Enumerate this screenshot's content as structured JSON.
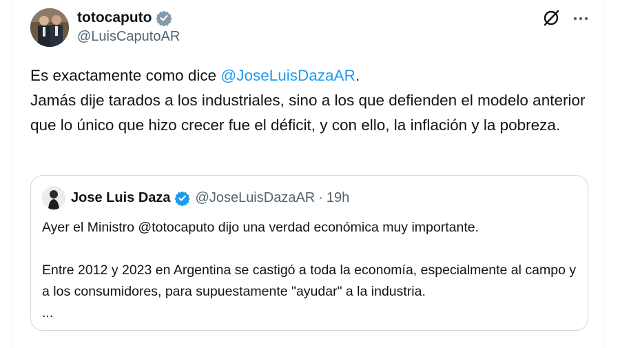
{
  "author": {
    "display_name": "totocaputo",
    "handle": "@LuisCaputoAR"
  },
  "tweet": {
    "text_prefix": "Es exactamente como dice ",
    "mention": "@JoseLuisDazaAR",
    "text_after_mention": ".",
    "text_line2": "Jamás dije tarados a los industriales, sino a los que defienden el modelo anterior que lo único que hizo crecer fue el déficit, y con ello, la inflación y la pobreza."
  },
  "quoted": {
    "display_name": "Jose Luis Daza",
    "handle": "@JoseLuisDazaAR",
    "separator": "·",
    "time": "19h",
    "paragraph1": "Ayer el Ministro @totocaputo dijo una verdad económica muy importante.",
    "paragraph2": "Entre 2012 y 2023 en Argentina se castigó a toda la economía, especialmente al campo y a los consumidores, para supuestamente \"ayudar\" a la industria.",
    "ellipsis": "..."
  },
  "icons": {
    "verified_gray": "gray-verified-badge-icon",
    "verified_blue": "blue-verified-badge-icon",
    "grok": "grok-icon",
    "more": "more-icon"
  },
  "colors": {
    "text": "#0f1419",
    "secondary": "#536471",
    "link": "#1d9bf0",
    "badge_gray": "#829aab",
    "badge_blue": "#1d9bf0",
    "border": "#cfd9de"
  }
}
